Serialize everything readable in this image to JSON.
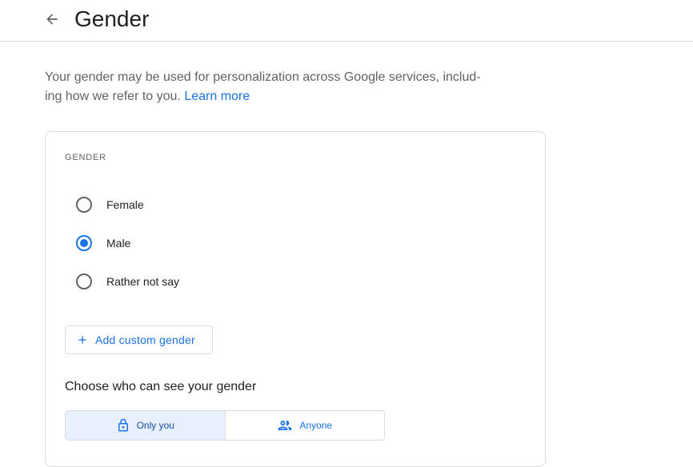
{
  "header": {
    "title": "Gender",
    "back_icon": "arrow-back-icon"
  },
  "intro": {
    "text": "Your gender may be used for personalization across Google services, includ-ing how we refer to you.",
    "link": "Learn more"
  },
  "gender_section": {
    "label": "GENDER",
    "options": [
      {
        "label": "Female",
        "selected": false
      },
      {
        "label": "Male",
        "selected": true
      },
      {
        "label": "Rather not say",
        "selected": false
      }
    ],
    "add_custom_label": "Add custom gender"
  },
  "visibility": {
    "title": "Choose who can see your gender",
    "options": [
      {
        "label": "Only you",
        "icon": "lock-icon",
        "selected": true
      },
      {
        "label": "Anyone",
        "icon": "people-icon",
        "selected": false
      }
    ]
  },
  "colors": {
    "accent": "#1a73e8",
    "selected_bg": "#e8f0fe",
    "border": "#dadce0",
    "muted_text": "#5f6368"
  }
}
